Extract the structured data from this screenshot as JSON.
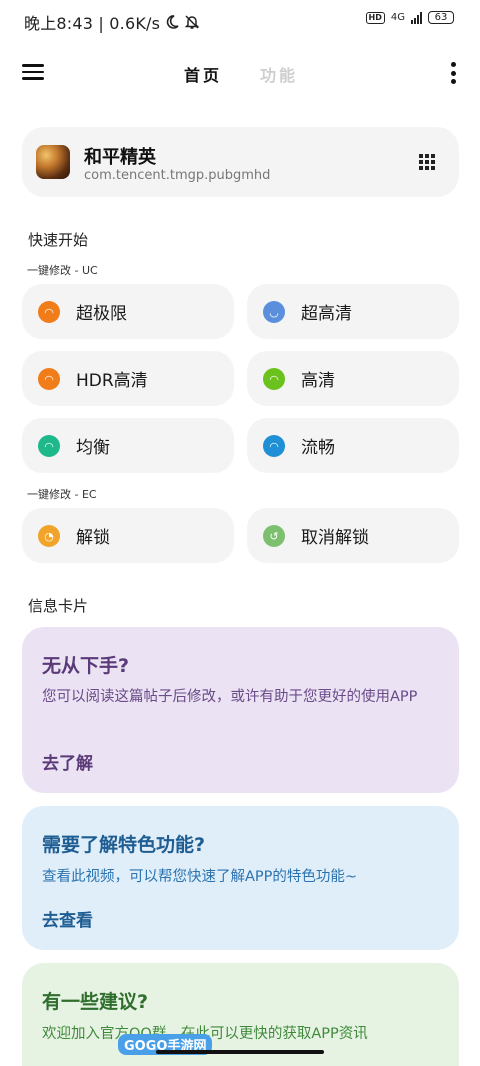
{
  "status_bar": {
    "time_speed": "晚上8:43 | 0.6K/s",
    "moon_icon": "moon-icon",
    "bell_icon": "bell-off-icon",
    "hd": "HD",
    "net": "4G",
    "battery": "63"
  },
  "app_bar": {
    "tab_home": "首页",
    "tab_function": "功能"
  },
  "app_card": {
    "name": "和平精英",
    "package": "com.tencent.tmgp.pubgmhd"
  },
  "quick_start": {
    "title": "快速开始",
    "uc_label": "一键修改 - UC",
    "uc_buttons": [
      {
        "label": "超极限",
        "color": "#f07d1a"
      },
      {
        "label": "超高清",
        "color": "#5b8fdc"
      },
      {
        "label": "HDR高清",
        "color": "#f07d1a"
      },
      {
        "label": "高清",
        "color": "#6cc21d"
      },
      {
        "label": "均衡",
        "color": "#1fb88a"
      },
      {
        "label": "流畅",
        "color": "#1f8fd6"
      }
    ],
    "ec_label": "一键修改 - EC",
    "ec_buttons": [
      {
        "label": "解锁",
        "color": "#f2a42a"
      },
      {
        "label": "取消解锁",
        "color": "#7cc06e"
      }
    ]
  },
  "info": {
    "title": "信息卡片",
    "cards": [
      {
        "title": "无从下手?",
        "desc": "您可以阅读这篇帖子后修改，或许有助于您更好的使用APP",
        "action": "去了解",
        "bg": "#ebe3f3",
        "fg": "#5a3a78"
      },
      {
        "title": "需要了解特色功能?",
        "desc": "查看此视频，可以帮您快速了解APP的特色功能~",
        "action": "去查看",
        "bg": "#e0eefa",
        "fg": "#1f5e92"
      },
      {
        "title": "有一些建议?",
        "desc": "欢迎加入官方QQ群，在此可以更快的获取APP资讯",
        "action": "",
        "bg": "#e6f3e3",
        "fg": "#2f6e2c"
      }
    ]
  },
  "watermark": "GOGO手游网"
}
